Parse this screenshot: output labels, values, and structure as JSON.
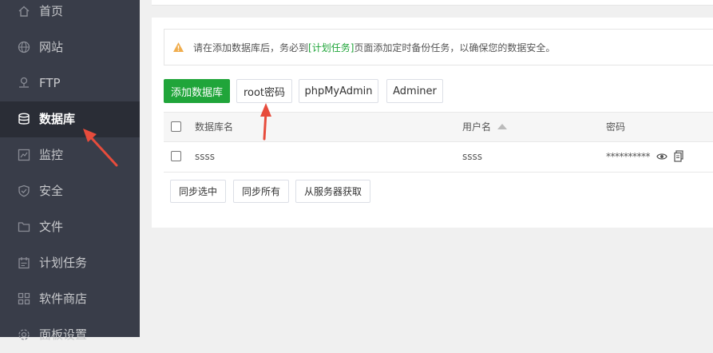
{
  "sidebar": {
    "items": [
      {
        "label": "首页",
        "icon": "home-icon"
      },
      {
        "label": "网站",
        "icon": "globe-icon"
      },
      {
        "label": "FTP",
        "icon": "ftp-icon"
      },
      {
        "label": "数据库",
        "icon": "database-icon",
        "active": true
      },
      {
        "label": "监控",
        "icon": "monitor-icon"
      },
      {
        "label": "安全",
        "icon": "shield-icon"
      },
      {
        "label": "文件",
        "icon": "folder-icon"
      },
      {
        "label": "计划任务",
        "icon": "calendar-icon"
      },
      {
        "label": "软件商店",
        "icon": "apps-icon"
      },
      {
        "label": "面板设置",
        "icon": "gear-icon"
      }
    ]
  },
  "notice": {
    "before": "请在添加数据库后，务必到",
    "link": "[计划任务]",
    "after": "页面添加定时备份任务，以确保您的数据安全。"
  },
  "toolbar": {
    "add_label": "添加数据库",
    "root_label": "root密码",
    "phpmyadmin_label": "phpMyAdmin",
    "adminer_label": "Adminer"
  },
  "table": {
    "headers": {
      "name": "数据库名",
      "user": "用户名",
      "password": "密码"
    },
    "rows": [
      {
        "name": "ssss",
        "user": "ssss",
        "password": "**********"
      }
    ]
  },
  "sync": {
    "selected_label": "同步选中",
    "all_label": "同步所有",
    "server_label": "从服务器获取"
  },
  "colors": {
    "sidebar_bg": "#393d49",
    "active_bg": "#2a2d36",
    "primary": "#20a53a",
    "warning": "#f0ad4e",
    "annotation_arrow": "#e74c3c"
  }
}
